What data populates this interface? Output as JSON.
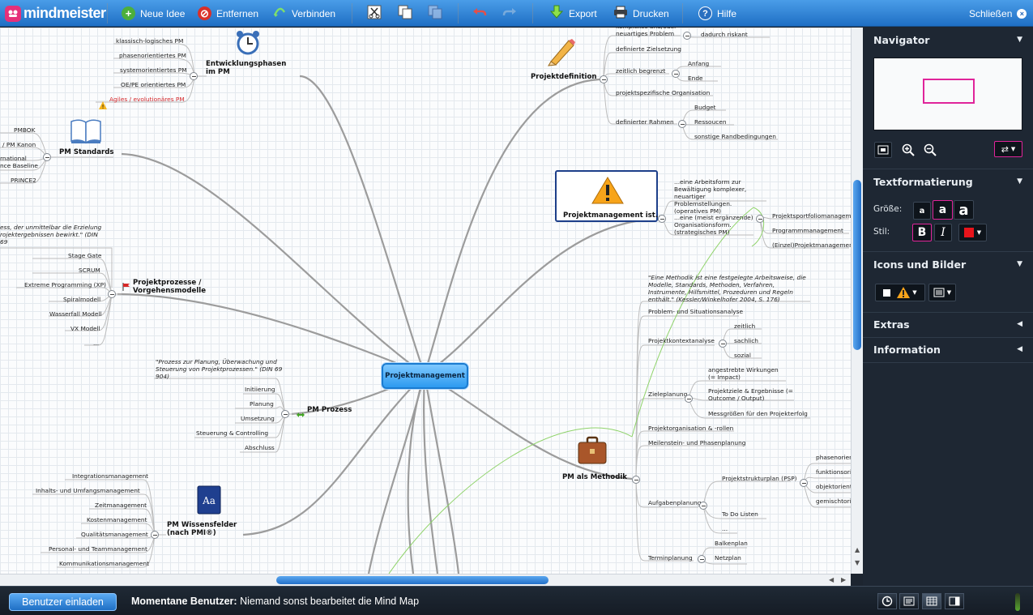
{
  "app": {
    "logo_text": "mindmeister"
  },
  "toolbar": {
    "new_idea": "Neue Idee",
    "remove": "Entfernen",
    "connect": "Verbinden",
    "export": "Export",
    "print": "Drucken",
    "help": "Hilfe",
    "close": "Schließen"
  },
  "map": {
    "central": "Projektmanagement",
    "phases": {
      "title": "Entwicklungsphasen im PM",
      "items": [
        "klassisch-logisches PM",
        "phasenorientiertes PM",
        "systemorientiertes PM",
        "OE/PE orientiertes PM",
        "Agiles / evolutionäres PM"
      ]
    },
    "standards": {
      "title": "PM Standards",
      "items": [
        "PMBOK",
        "/ PM Kanon",
        "rnational",
        "nce Baseline",
        "PRINCE2"
      ]
    },
    "processes": {
      "quote": "ess, der unmittelbar die Erzielung rojektergebnissen bewirkt.\" (DIN 69",
      "title": "Projektprozesse / Vorgehensmodelle",
      "items": [
        "Stage Gate",
        "SCRUM",
        "Extreme Programming (XP)",
        "Spiralmodell",
        "Wasserfall Modell",
        "VX Modell",
        "..."
      ]
    },
    "pm_process": {
      "quote": "\"Prozess zur Planung, Überwachung und Steuerung von Projektprozessen.\" (DIN 69 904)",
      "title": "PM Prozess",
      "items": [
        "Initiierung",
        "Planung",
        "Umsetzung",
        "Steuerung & Controlling",
        "Abschluss"
      ]
    },
    "knowledge": {
      "title": "PM Wissensfelder (nach PMI®)",
      "items": [
        "Integrationsmanagement",
        "Inhalts- und Umfangsmanagement",
        "Zeitmanagement",
        "Kostenmanagement",
        "Qualitätsmanagement",
        "Personal- und Teammanagement",
        "Kommunikationsmanagement"
      ]
    },
    "definition": {
      "title": "Projektdefinition",
      "items": [
        "komplexes und/oder neuartiges Problem",
        "dadurch riskant",
        "definierte Zielsetzung",
        "zeitlich begrenzt",
        "Anfang",
        "Ende",
        "projektspezifische Organisation",
        "definierter Rahmen",
        "Budget",
        "Ressoucen",
        "sonstige Randbedingungen"
      ]
    },
    "is": {
      "title": "Projektmanagement ist...",
      "items": [
        "...eine Arbeitsform zur Bewältigung komplexer, neuartiger Problemstellungen. (operatives PM)",
        "...eine (meist ergänzende) Organisationsform. (strategisches PM)",
        "Projektsportfoliomanagement",
        "Programmmanagement",
        "(Einzel)Projektmanagement"
      ]
    },
    "method": {
      "title": "PM als Methodik",
      "quote": "\"Eine Methodik ist eine festgelegte Arbeitsweise, die Modelle, Standards, Methoden, Verfahren, Instrumente, Hilfsmittel, Prozeduren und Regeln enthält.\" (Kessler/Winkelhofer 2004, S. 176)",
      "items": [
        "Problem- und Situationsanalyse",
        "Projektkontextanalyse",
        "zeitlich",
        "sachlich",
        "sozial",
        "angestrebte Wirkungen (= Impact)",
        "Zieleplanung",
        "Projektziele & Ergebnisse (= Outcome / Output)",
        "Messgrößen für den Projekterfolg",
        "Projektorganisation & -rollen",
        "Meilenstein- und Phasenplanung",
        "Projektstrukturplan (PSP)",
        "phasenorient",
        "funktionsori",
        "objektorient",
        "gemischtorie",
        "Aufgabenplanung",
        "To Do Listen",
        "...",
        "Balkenplan",
        "Terminplanung",
        "Netzplan"
      ]
    }
  },
  "panel": {
    "navigator": "Navigator",
    "text_format": "Textformatierung",
    "size_label": "Größe:",
    "style_label": "Stil:",
    "bold": "B",
    "italic": "I",
    "size_small": "a",
    "size_medium": "a",
    "size_large": "a",
    "icons": "Icons und Bilder",
    "extras": "Extras",
    "information": "Information",
    "accent_color": "#e0249a",
    "text_color": "#e8141b"
  },
  "bottom": {
    "invite": "Benutzer einladen",
    "users_label": "Momentane Benutzer:",
    "users_value": "Niemand sonst bearbeitet die Mind Map"
  }
}
